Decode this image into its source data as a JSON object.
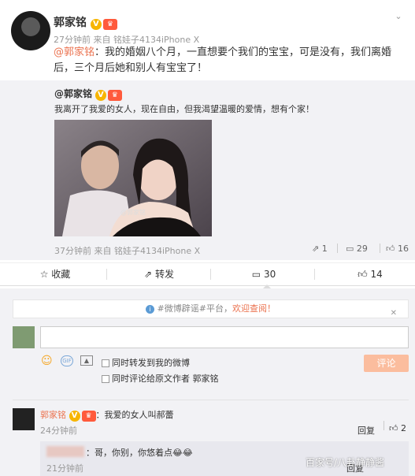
{
  "post": {
    "author": "郭家铭",
    "time": "27分钟前",
    "source_prefix": "来自",
    "source": "铭娃子4134iPhone X",
    "mention": "@郭家铭",
    "text": "：我的婚姻八个月，一直想要个我们的宝宝，可是没有，我们离婚后，三个月后她和别人有宝宝了！"
  },
  "repost": {
    "author_mention": "@郭家铭",
    "text": "我离开了我爱的女人，现在自由，但我渴望温暖的爱情，想有个家！",
    "image_watermark": "@郭家铭",
    "time": "37分钟前",
    "source_prefix": "来自",
    "source": "铭娃子4134iPhone X",
    "reposts": "1",
    "comments": "29",
    "likes": "16"
  },
  "actions": {
    "favorite": "收藏",
    "repost": "转发",
    "comments": "30",
    "likes": "14"
  },
  "notice": {
    "prefix": "#微博辟谣#平台，",
    "link": "欢迎查阅！"
  },
  "composer": {
    "input_value": "",
    "opt_repost": "同时转发到我的微博",
    "opt_comment_prefix": "同时评论给原文作者",
    "opt_comment_author": "郭家铭",
    "submit": "评论"
  },
  "comments": [
    {
      "author": "郭家铭",
      "text": "：我爱的女人叫郝蕾",
      "time": "24分钟前",
      "reply": "回复",
      "likes": "2"
    }
  ],
  "sub_reply": {
    "text": "：哥，你别，你悠着点",
    "time": "21分钟前",
    "reply": "回复"
  },
  "watermark": "百家号/八卦静静酱",
  "colors": {
    "accent": "#eb7350",
    "vip": "#f7b500",
    "bg_gray": "#f2f2f5"
  }
}
